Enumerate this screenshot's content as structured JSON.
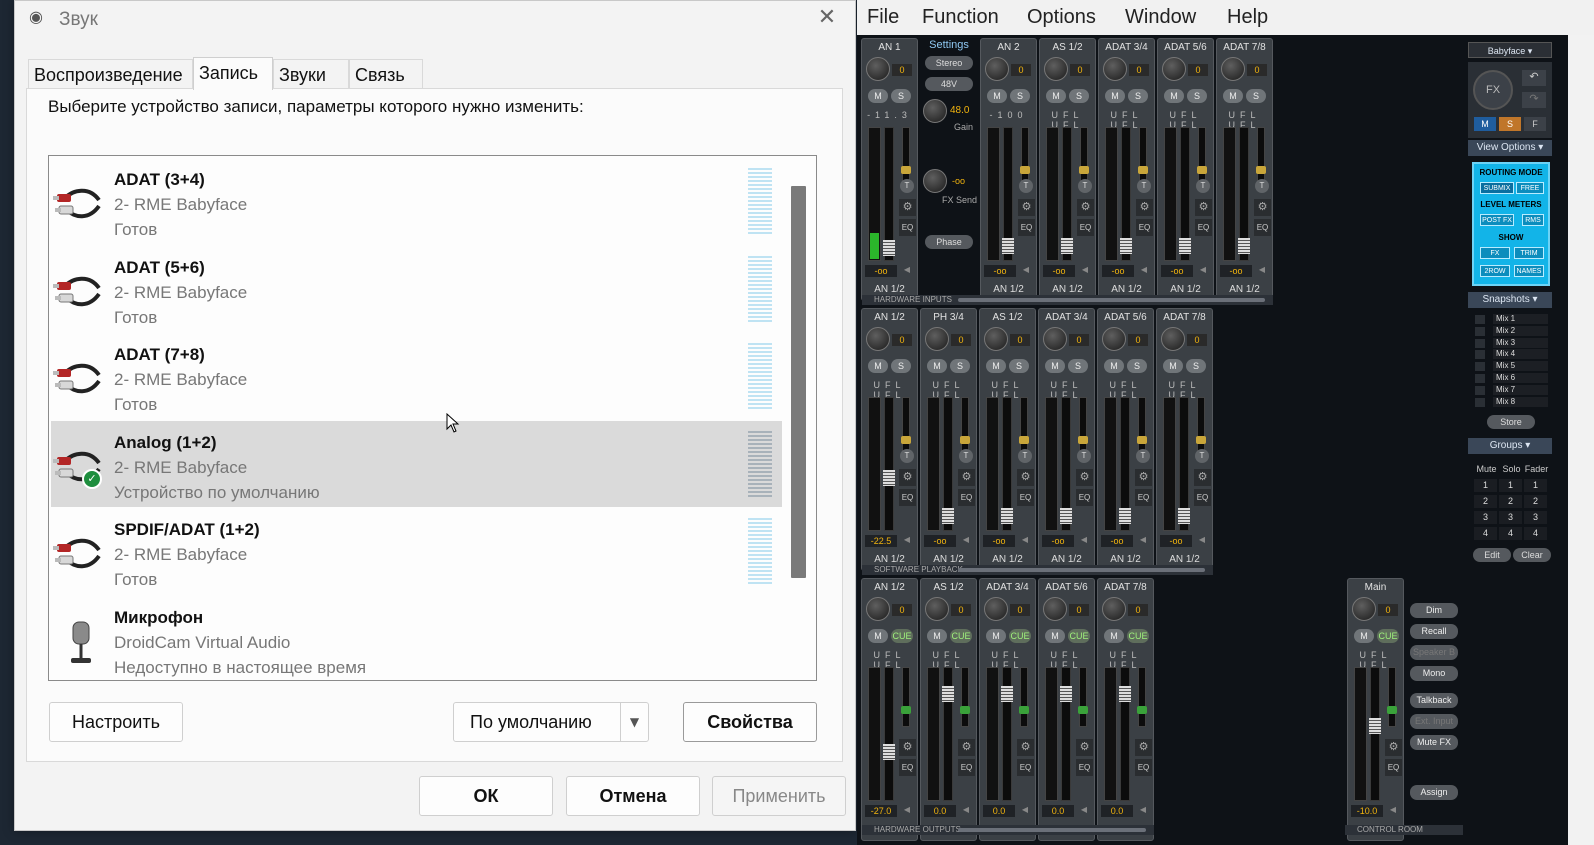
{
  "dialog": {
    "title": "Звук",
    "tabs": [
      "Воспроизведение",
      "Запись",
      "Звуки",
      "Связь"
    ],
    "instruction": "Выберите устройство записи, параметры которого нужно изменить:",
    "devices": [
      {
        "name": "ADAT (3+4)",
        "driver": "2- RME Babyface",
        "status": "Готов",
        "icon": "rca-cable-icon"
      },
      {
        "name": "ADAT (5+6)",
        "driver": "2- RME Babyface",
        "status": "Готов",
        "icon": "rca-cable-icon"
      },
      {
        "name": "ADAT (7+8)",
        "driver": "2- RME Babyface",
        "status": "Готов",
        "icon": "rca-cable-icon"
      },
      {
        "name": "Analog (1+2)",
        "driver": "2- RME Babyface",
        "status": "Устройство по умолчанию",
        "icon": "rca-cable-icon",
        "selected": true,
        "default": true
      },
      {
        "name": "SPDIF/ADAT (1+2)",
        "driver": "2- RME Babyface",
        "status": "Готов",
        "icon": "rca-cable-icon"
      },
      {
        "name": "Микрофон",
        "driver": "DroidCam Virtual Audio",
        "status": "Недоступно в настоящее время",
        "icon": "microphone-icon"
      }
    ],
    "buttons": {
      "configure": "Настроить",
      "default": "По умолчанию",
      "properties": "Свойства",
      "ok": "ОК",
      "cancel": "Отмена",
      "apply": "Применить"
    }
  },
  "mixer": {
    "menu": [
      "File",
      "Function",
      "Options",
      "Window",
      "Help"
    ],
    "device": "Babyface",
    "settings": {
      "label": "Settings",
      "stereo": "Stereo",
      "phantom": "48V",
      "gain_value": "48.0",
      "gain_label": "Gain",
      "fx_send_value": "-oo",
      "fx_send_label": "FX Send",
      "phase": "Phase"
    },
    "sections": {
      "hardware_inputs": "HARDWARE INPUTS",
      "software_playback": "SOFTWARE PLAYBACK",
      "hardware_outputs": "HARDWARE OUTPUTS",
      "control_room": "CONTROL ROOM"
    },
    "inputs": [
      {
        "name": "AN 1",
        "knob": "0",
        "peak": "-11.3",
        "fader": "-oo",
        "route": "AN 1/2"
      },
      {
        "name": "AN 2",
        "knob": "0",
        "peak": "-100",
        "fader": "-oo",
        "route": "AN 1/2"
      },
      {
        "name": "AS 1/2",
        "knob": "0",
        "peak": "UFL  UFL",
        "fader": "-oo",
        "route": "AN 1/2"
      },
      {
        "name": "ADAT 3/4",
        "knob": "0",
        "peak": "UFL  UFL",
        "fader": "-oo",
        "route": "AN 1/2"
      },
      {
        "name": "ADAT 5/6",
        "knob": "0",
        "peak": "UFL  UFL",
        "fader": "-oo",
        "route": "AN 1/2"
      },
      {
        "name": "ADAT 7/8",
        "knob": "0",
        "peak": "UFL  UFL",
        "fader": "-oo",
        "route": "AN 1/2"
      }
    ],
    "playback": [
      {
        "name": "AN 1/2",
        "knob": "0",
        "fader": "-22.5",
        "route": "AN 1/2"
      },
      {
        "name": "PH 3/4",
        "knob": "0",
        "fader": "-oo",
        "route": "AN 1/2"
      },
      {
        "name": "AS 1/2",
        "knob": "0",
        "fader": "-oo",
        "route": "AN 1/2"
      },
      {
        "name": "ADAT 3/4",
        "knob": "0",
        "fader": "-oo",
        "route": "AN 1/2"
      },
      {
        "name": "ADAT 5/6",
        "knob": "0",
        "fader": "-oo",
        "route": "AN 1/2"
      },
      {
        "name": "ADAT 7/8",
        "knob": "0",
        "fader": "-oo",
        "route": "AN 1/2"
      }
    ],
    "outputs": [
      {
        "name": "AN 1/2",
        "knob": "0",
        "fader": "-27.0"
      },
      {
        "name": "AS 1/2",
        "knob": "0",
        "fader": "0.0"
      },
      {
        "name": "ADAT 3/4",
        "knob": "0",
        "fader": "0.0"
      },
      {
        "name": "ADAT 5/6",
        "knob": "0",
        "fader": "0.0"
      },
      {
        "name": "ADAT 7/8",
        "knob": "0",
        "fader": "0.0"
      }
    ],
    "main": {
      "name": "Main",
      "knob": "0",
      "fader": "-10.0"
    },
    "control_buttons": [
      "Dim",
      "Recall",
      "Speaker B",
      "Mono",
      "Talkback",
      "Ext. Input",
      "Mute FX",
      "Assign"
    ],
    "view_options": "View Options",
    "routing": {
      "mode": "ROUTING MODE",
      "submix": "SUBMIX",
      "free": "FREE",
      "meters": "LEVEL METERS",
      "postfx": "POST FX",
      "rms": "RMS",
      "show": "SHOW",
      "fx": "FX",
      "trim": "TRIM",
      "row2": "2ROW",
      "names": "NAMES"
    },
    "msf": [
      "M",
      "S",
      "F"
    ],
    "fx": "FX",
    "snapshots": {
      "title": "Snapshots",
      "items": [
        "Mix 1",
        "Mix 2",
        "Mix 3",
        "Mix 4",
        "Mix 5",
        "Mix 6",
        "Mix 7",
        "Mix 8"
      ],
      "store": "Store"
    },
    "groups": {
      "title": "Groups",
      "headers": [
        "Mute",
        "Solo",
        "Fader"
      ],
      "rows": [
        "1",
        "2",
        "3",
        "4"
      ],
      "edit": "Edit",
      "clear": "Clear"
    },
    "labels": {
      "m": "M",
      "s": "S",
      "cue": "CUE",
      "t": "T",
      "eq": "EQ",
      "ufl": "UFL UFL"
    }
  }
}
